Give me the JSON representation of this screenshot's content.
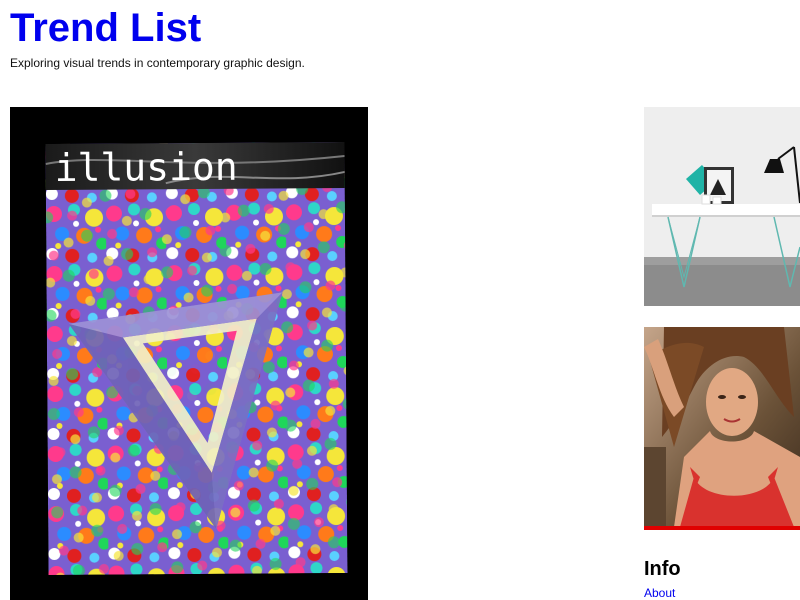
{
  "site": {
    "title": "Trend List",
    "tagline": "Exploring visual trends in contemporary graphic design."
  },
  "featured": {
    "poster_word": "illusion"
  },
  "sidebar": {
    "info_heading": "Info",
    "about_label": "About"
  },
  "colors": {
    "link": "#0000ee",
    "poster_background": "#000000",
    "accent_red": "#e00000"
  }
}
